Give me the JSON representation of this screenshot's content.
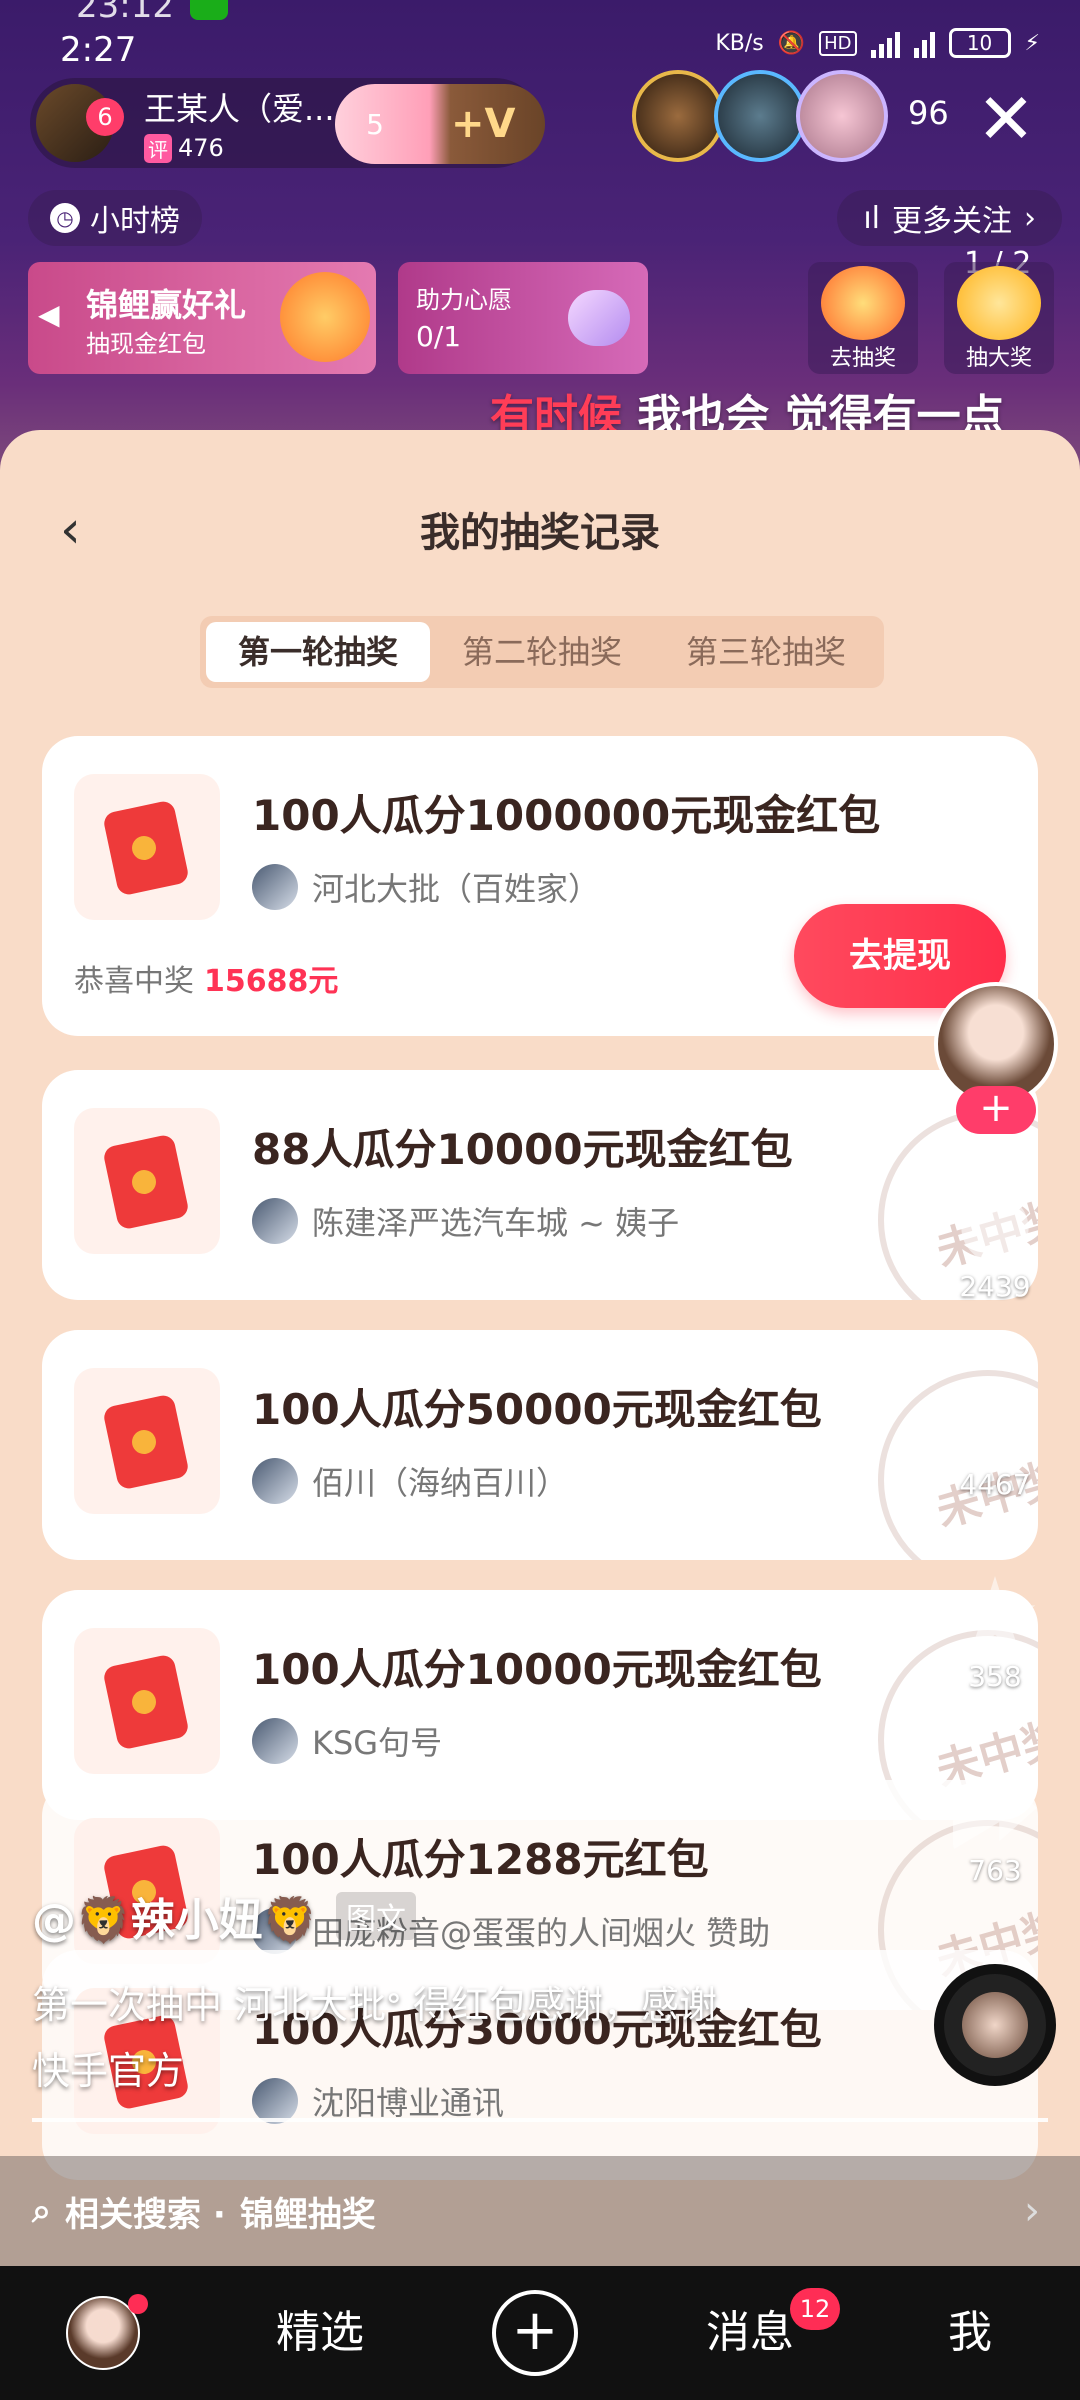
{
  "status_bar": {
    "time_partial": "23:12",
    "time": "2:27",
    "network_speed": "KB/s",
    "battery": "10",
    "icons": [
      "wechat-icon",
      "mute-icon",
      "hd-icon",
      "4g-icon",
      "signal-icon",
      "wifi-icon",
      "battery-icon",
      "charging-icon"
    ]
  },
  "live": {
    "host_name": "王某人（爱...",
    "host_badge": "6",
    "host_tag": "评",
    "host_count": "476",
    "fans_level": "5",
    "fans_plus": "+V",
    "viewer_count": "96",
    "hourly_label": "小时榜",
    "more_follow": "更多关注",
    "koi_title": "锦鲤赢好礼",
    "koi_sub": "抽现金红包",
    "wish_title": "助力心愿",
    "wish_progress": "0/1",
    "act1_label": "去抽奖",
    "act2_label": "抽大奖",
    "page_indicator": "1 / 2",
    "subtitle_highlight": "有时候",
    "subtitle_rest": " 我也会 觉得有一点"
  },
  "sheet": {
    "title": "我的抽奖记录",
    "tabs": [
      {
        "label": "第一轮抽奖",
        "active": true
      },
      {
        "label": "第二轮抽奖",
        "active": false
      },
      {
        "label": "第三轮抽奖",
        "active": false
      }
    ],
    "records": [
      {
        "title": "100人瓜分1000000元现金红包",
        "shop": "河北大批（百姓家）",
        "congrats": "恭喜中奖",
        "amount": "15688元",
        "button": "去提现"
      },
      {
        "title": "88人瓜分10000元现金红包",
        "shop": "陈建泽严选汽车城 ~ 姨子",
        "stamp": "未中奖"
      },
      {
        "title": "100人瓜分50000元现金红包",
        "shop": "佰川（海纳百川）",
        "stamp": "未中奖"
      },
      {
        "title": "100人瓜分10000元现金红包",
        "shop": "KSG句号",
        "stamp": "未中奖"
      },
      {
        "title": "100人瓜分1288元红包",
        "shop": "田庞粉音@蛋蛋的人间烟火 赞助",
        "stamp": "未中奖"
      },
      {
        "title": "100人瓜分30000元现金红包",
        "shop": "沈阳博业通讯"
      }
    ]
  },
  "rail": {
    "likes": "2439",
    "comments": "4467",
    "favorites": "358",
    "shares": "763",
    "follow_plus": "+"
  },
  "caption": {
    "user": "@🦁辣小妞🦁",
    "tag": "图文",
    "line1": "第一次抽中 河北大批ᐤ 得红包感谢，感谢",
    "line2": "快手官方"
  },
  "related": {
    "prefix": "相关搜索 ·",
    "keyword": "锦鲤抽奖"
  },
  "nav": {
    "featured": "精选",
    "messages": "消息",
    "messages_badge": "12",
    "me": "我"
  }
}
